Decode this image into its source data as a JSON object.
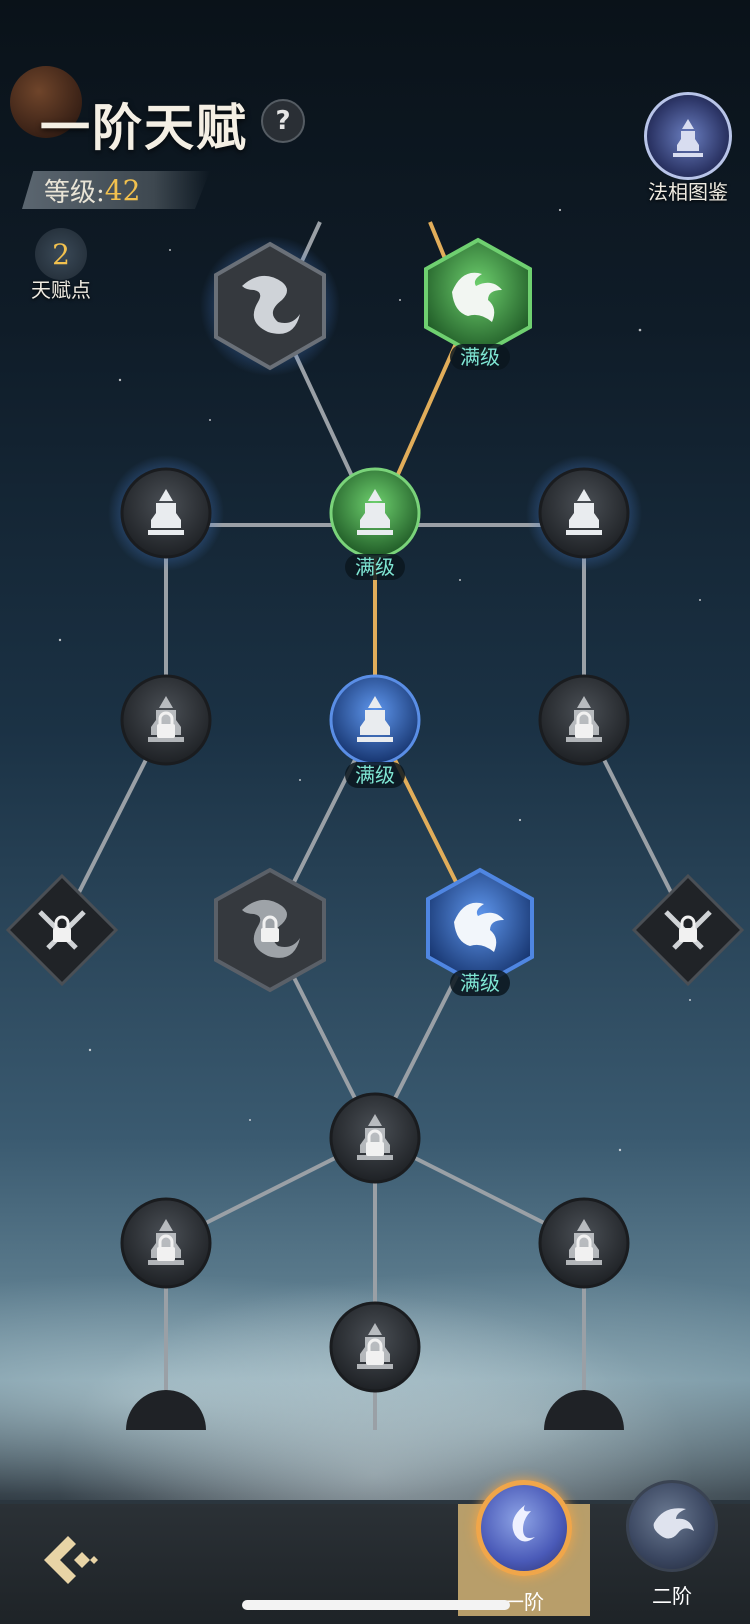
{
  "header": {
    "title": "一阶天赋",
    "help_icon": "?",
    "level_label": "等级:",
    "level_value": "42",
    "talent_points_value": "2",
    "talent_points_label": "天赋点",
    "codex_label": "法相图鉴"
  },
  "tree": {
    "max_label": "满级",
    "colors": {
      "gold_link": "#e1ad5a",
      "grey_link": "#9aa0a6",
      "green_node": "#4aa84a",
      "blue_node": "#2f6fd1",
      "locked_node": "#2a2d31"
    }
  },
  "footer": {
    "tier1_label": "一阶",
    "tier2_label": "二阶"
  }
}
